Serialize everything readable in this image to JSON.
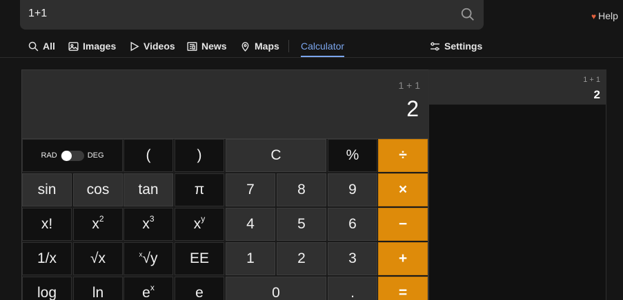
{
  "search": {
    "value": "1+1"
  },
  "header": {
    "help_label": "Help"
  },
  "tabs": [
    {
      "label": "All",
      "icon": "search-icon"
    },
    {
      "label": "Images",
      "icon": "image-icon"
    },
    {
      "label": "Videos",
      "icon": "play-icon"
    },
    {
      "label": "News",
      "icon": "newspaper-icon"
    },
    {
      "label": "Maps",
      "icon": "map-pin-icon"
    },
    {
      "label": "Calculator",
      "active": true
    },
    {
      "label": "Settings",
      "icon": "sliders-icon"
    }
  ],
  "calculator": {
    "expression": "1 + 1",
    "result": "2",
    "mode": {
      "rad": "RAD",
      "deg": "DEG",
      "selected": "RAD"
    },
    "keys": {
      "lparen": "(",
      "rparen": ")",
      "clear": "C",
      "percent": "%",
      "divide": "÷",
      "sin": "sin",
      "cos": "cos",
      "tan": "tan",
      "pi": "π",
      "multiply": "×",
      "factorial": "x!",
      "x2_base": "x",
      "x2_sup": "2",
      "x3_base": "x",
      "x3_sup": "3",
      "xy_base": "x",
      "xy_sup": "y",
      "minus": "−",
      "reciprocal": "1/x",
      "sqrt": "√x",
      "yroot_pre": "x",
      "yroot_main": "√y",
      "ee": "EE",
      "plus": "+",
      "log": "log",
      "ln": "ln",
      "ex_base": "e",
      "ex_sup": "x",
      "e": "e",
      "decimal": ".",
      "equals": "=",
      "d0": "0",
      "d1": "1",
      "d2": "2",
      "d3": "3",
      "d4": "4",
      "d5": "5",
      "d6": "6",
      "d7": "7",
      "d8": "8",
      "d9": "9"
    }
  },
  "history": [
    {
      "expression": "1 + 1",
      "result": "2"
    }
  ],
  "colors": {
    "operator": "#de8b0a",
    "active_tab": "#7ba6ee",
    "background": "#151515"
  }
}
